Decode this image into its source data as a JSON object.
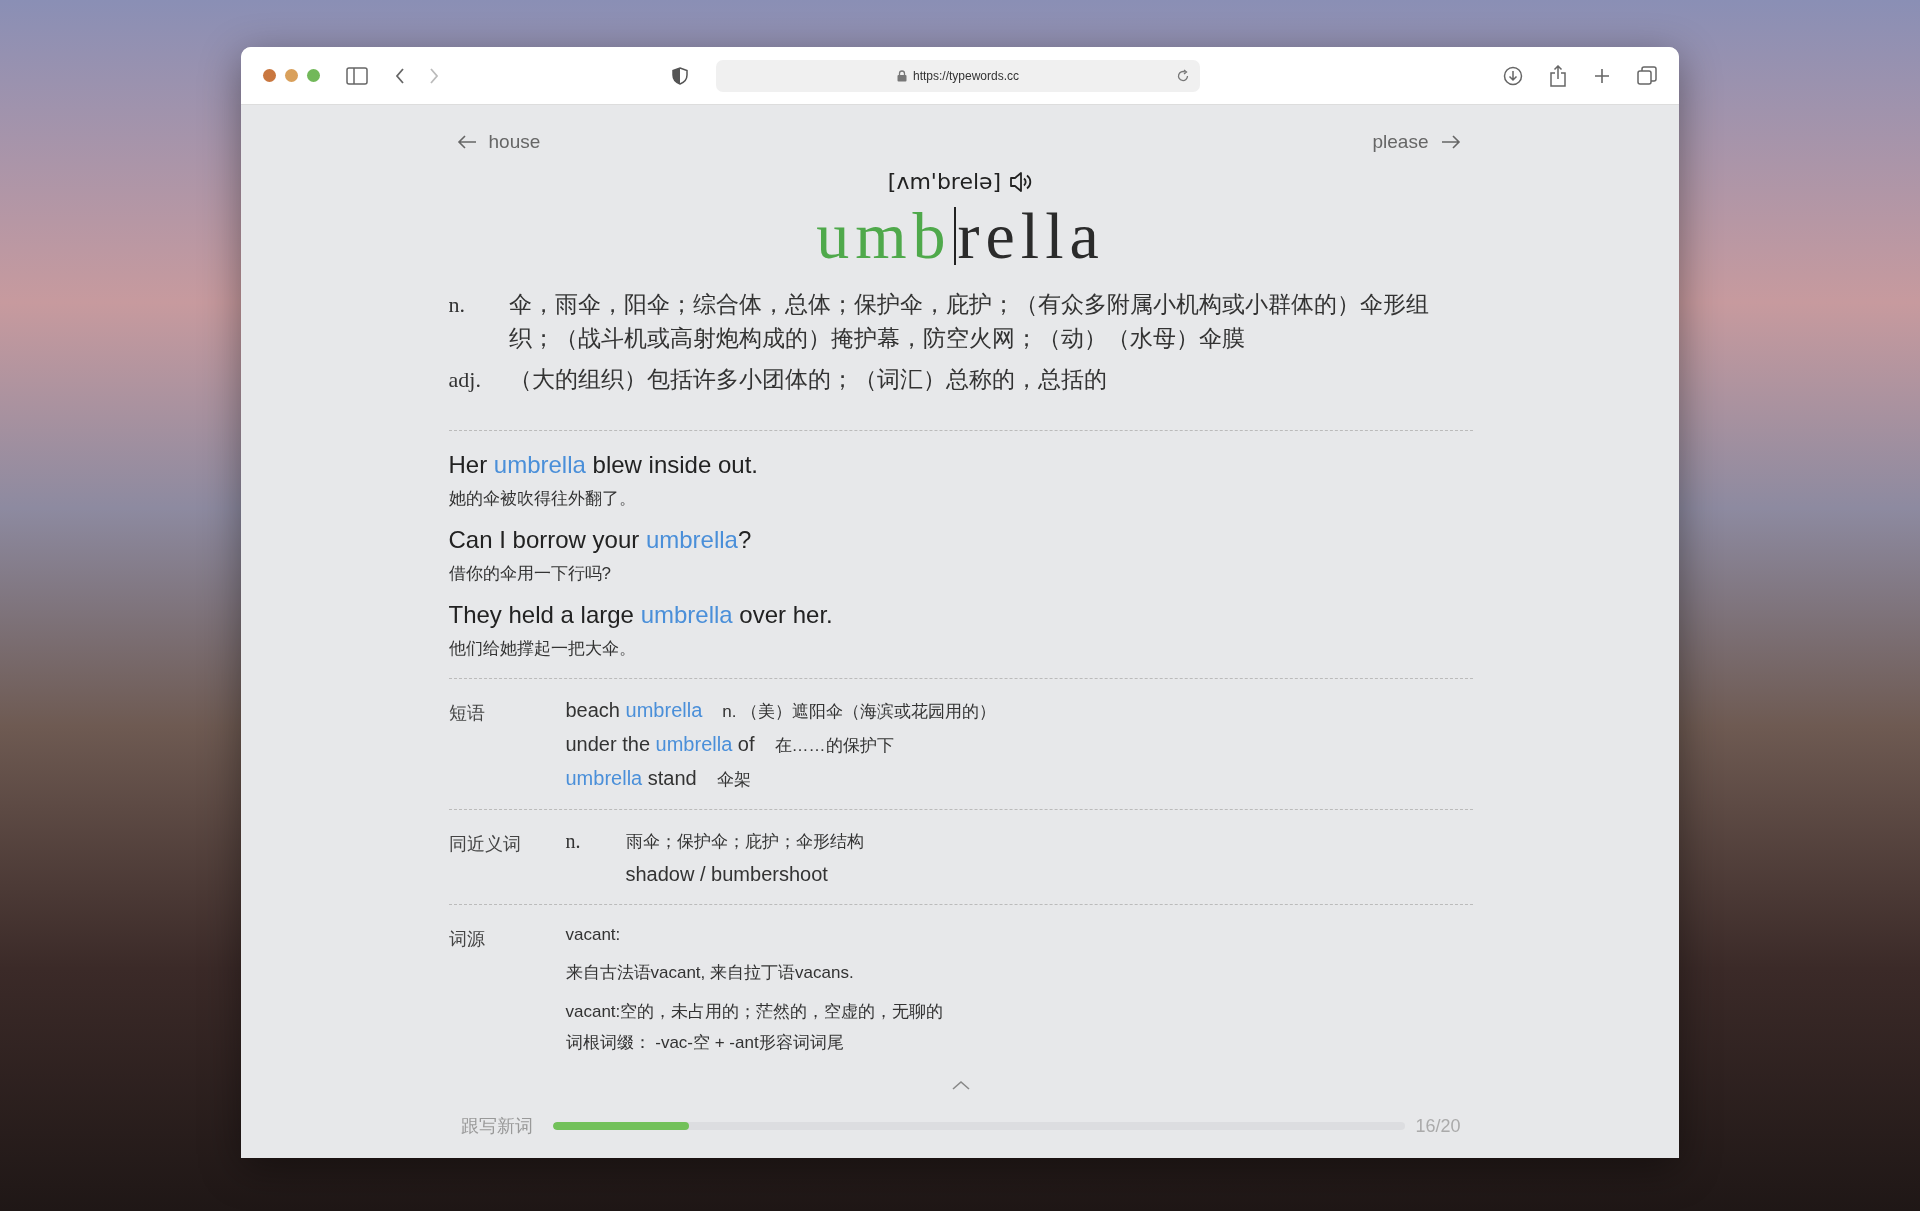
{
  "browser": {
    "url": "https://typewords.cc"
  },
  "nav": {
    "previous": "house",
    "next": "please"
  },
  "word": {
    "phonetic": "[ʌm'brelə]",
    "typed": "umb",
    "remaining": "rella"
  },
  "definitions": [
    {
      "pos": "n.",
      "text": "伞，雨伞，阳伞；综合体，总体；保护伞，庇护；（有众多附属小机构或小群体的）伞形组织；（战斗机或高射炮构成的）掩护幕，防空火网；（动）（水母）伞膜"
    },
    {
      "pos": "adj.",
      "text": "（大的组织）包括许多小团体的；（词汇）总称的，总括的"
    }
  ],
  "examples": [
    {
      "parts": [
        {
          "text": "Her ",
          "highlight": false
        },
        {
          "text": "umbrella",
          "highlight": true
        },
        {
          "text": " blew inside out.",
          "highlight": false
        }
      ],
      "translation": "她的伞被吹得往外翻了。"
    },
    {
      "parts": [
        {
          "text": "Can I borrow your ",
          "highlight": false
        },
        {
          "text": "umbrella",
          "highlight": true
        },
        {
          "text": "?",
          "highlight": false
        }
      ],
      "translation": "借你的伞用一下行吗?"
    },
    {
      "parts": [
        {
          "text": "They held a large ",
          "highlight": false
        },
        {
          "text": "umbrella",
          "highlight": true
        },
        {
          "text": " over her.",
          "highlight": false
        }
      ],
      "translation": "他们给她撑起一把大伞。"
    }
  ],
  "phrases": {
    "label": "短语",
    "items": [
      {
        "parts": [
          {
            "text": "beach ",
            "highlight": false
          },
          {
            "text": "umbrella",
            "highlight": true
          }
        ],
        "meaning": "n. （美）遮阳伞（海滨或花园用的）"
      },
      {
        "parts": [
          {
            "text": "under the ",
            "highlight": false
          },
          {
            "text": "umbrella",
            "highlight": true
          },
          {
            "text": " of",
            "highlight": false
          }
        ],
        "meaning": "在……的保护下"
      },
      {
        "parts": [
          {
            "text": "umbrella",
            "highlight": true
          },
          {
            "text": " stand",
            "highlight": false
          }
        ],
        "meaning": "伞架"
      }
    ]
  },
  "synonyms": {
    "label": "同近义词",
    "pos": "n.",
    "meaning": "雨伞；保护伞；庇护；伞形结构",
    "words": "shadow / bumbershoot"
  },
  "etymology": {
    "label": "词源",
    "lines": [
      "vacant:",
      "来自古法语vacant, 来自拉丁语vacans.",
      "vacant:空的，未占用的；茫然的，空虚的，无聊的",
      "词根词缀： -vac-空 + -ant形容词词尾"
    ]
  },
  "progress": {
    "label": "跟写新词",
    "count": "16/20",
    "level": 0.16
  }
}
